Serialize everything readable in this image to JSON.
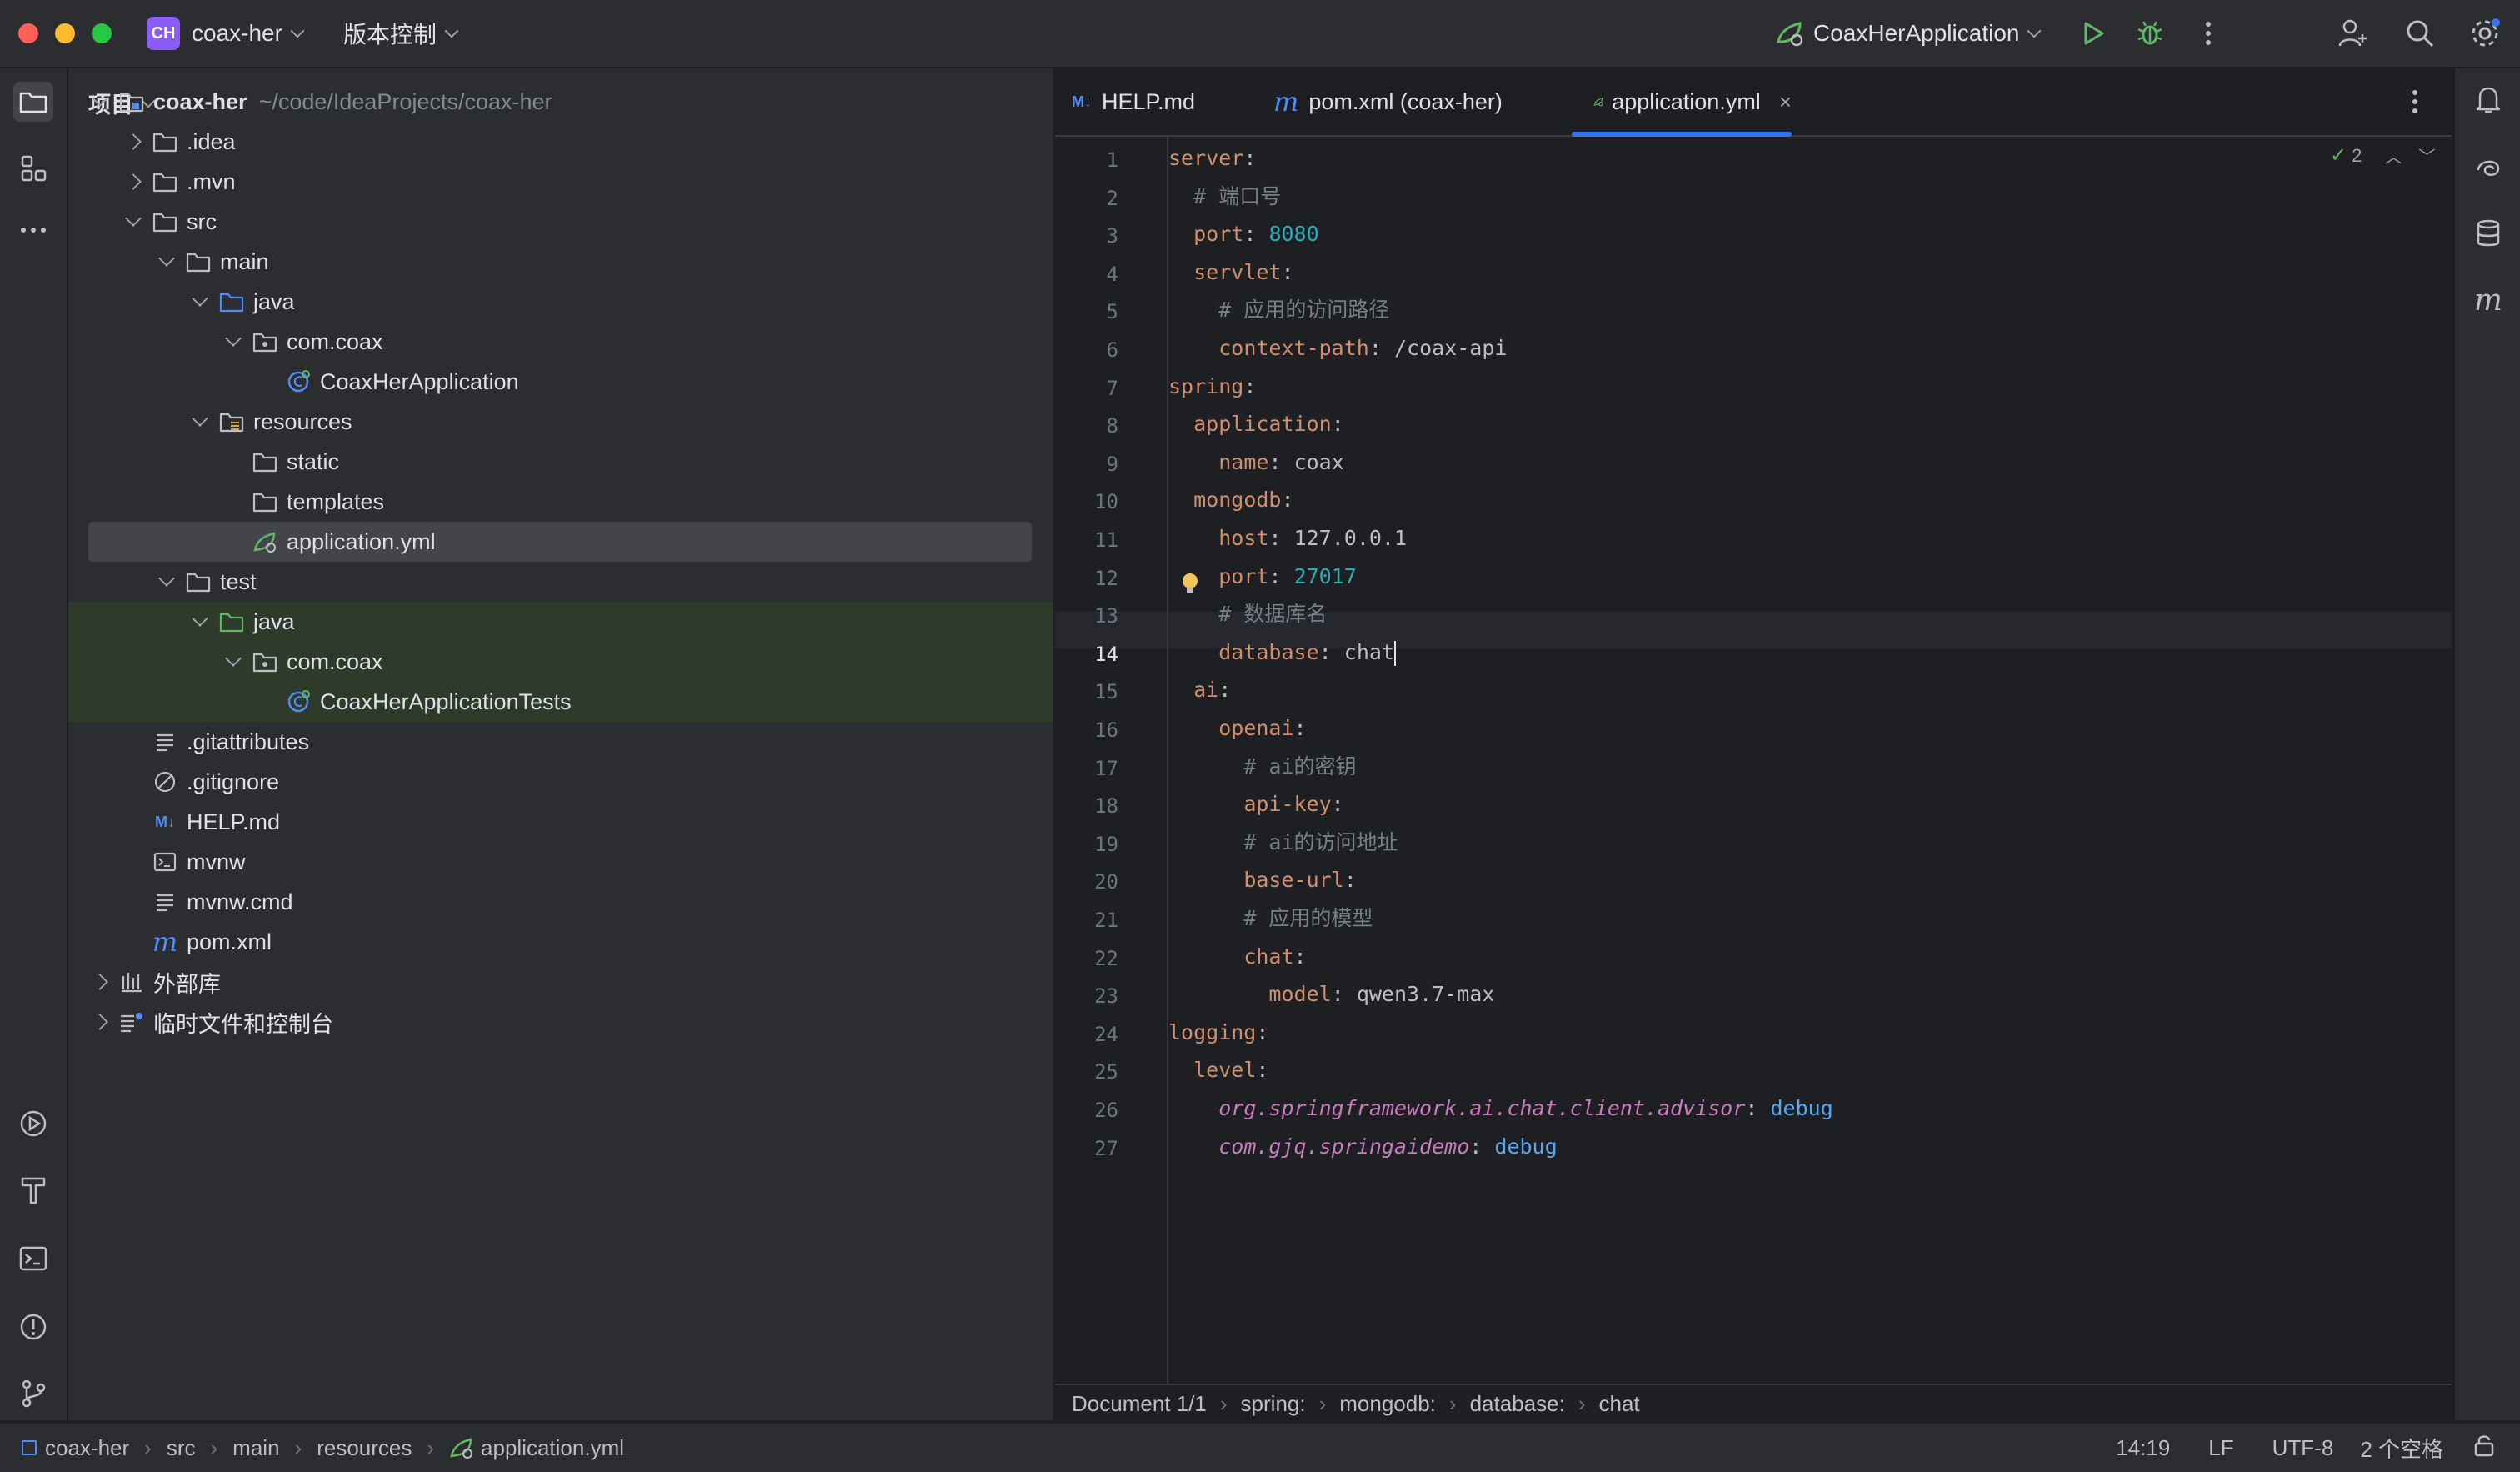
{
  "titlebar": {
    "project_badge": "CH",
    "project_name": "coax-her",
    "vcs_menu": "版本控制",
    "run_config": "CoaxHerApplication"
  },
  "project_panel": {
    "title": "项目",
    "tree": [
      {
        "label": "coax-her",
        "hint": "~/code/IdeaProjects/coax-her",
        "depth": 0,
        "arrow": "down",
        "icon": "module-folder-icon",
        "bold": true
      },
      {
        "label": ".idea",
        "depth": 1,
        "arrow": "right",
        "icon": "folder-icon"
      },
      {
        "label": ".mvn",
        "depth": 1,
        "arrow": "right",
        "icon": "folder-icon"
      },
      {
        "label": "src",
        "depth": 1,
        "arrow": "down",
        "icon": "folder-icon"
      },
      {
        "label": "main",
        "depth": 2,
        "arrow": "down",
        "icon": "folder-icon"
      },
      {
        "label": "java",
        "depth": 3,
        "arrow": "down",
        "icon": "source-folder-icon"
      },
      {
        "label": "com.coax",
        "depth": 4,
        "arrow": "down",
        "icon": "package-icon"
      },
      {
        "label": "CoaxHerApplication",
        "depth": 5,
        "arrow": "",
        "icon": "spring-class-icon"
      },
      {
        "label": "resources",
        "depth": 3,
        "arrow": "down",
        "icon": "resources-folder-icon"
      },
      {
        "label": "static",
        "depth": 4,
        "arrow": "",
        "icon": "folder-icon"
      },
      {
        "label": "templates",
        "depth": 4,
        "arrow": "",
        "icon": "folder-icon"
      },
      {
        "label": "application.yml",
        "depth": 4,
        "arrow": "",
        "icon": "spring-yml-icon",
        "selected": true
      },
      {
        "label": "test",
        "depth": 2,
        "arrow": "down",
        "icon": "folder-icon"
      },
      {
        "label": "java",
        "depth": 3,
        "arrow": "down",
        "icon": "test-folder-icon",
        "test": true
      },
      {
        "label": "com.coax",
        "depth": 4,
        "arrow": "down",
        "icon": "package-icon",
        "test": true
      },
      {
        "label": "CoaxHerApplicationTests",
        "depth": 5,
        "arrow": "",
        "icon": "spring-class-icon",
        "test": true
      },
      {
        "label": ".gitattributes",
        "depth": 1,
        "arrow": "",
        "icon": "text-file-icon"
      },
      {
        "label": ".gitignore",
        "depth": 1,
        "arrow": "",
        "icon": "ignore-file-icon"
      },
      {
        "label": "HELP.md",
        "depth": 1,
        "arrow": "",
        "icon": "markdown-icon"
      },
      {
        "label": "mvnw",
        "depth": 1,
        "arrow": "",
        "icon": "shell-script-icon"
      },
      {
        "label": "mvnw.cmd",
        "depth": 1,
        "arrow": "",
        "icon": "text-file-icon"
      },
      {
        "label": "pom.xml",
        "depth": 1,
        "arrow": "",
        "icon": "maven-icon"
      },
      {
        "label": "外部库",
        "depth": 0,
        "arrow": "right",
        "icon": "library-icon"
      },
      {
        "label": "临时文件和控制台",
        "depth": 0,
        "arrow": "right",
        "icon": "scratch-icon"
      }
    ]
  },
  "editor": {
    "tabs": [
      {
        "label": "HELP.md",
        "icon": "markdown-icon"
      },
      {
        "label": "pom.xml (coax-her)",
        "icon": "maven-icon"
      },
      {
        "label": "application.yml",
        "icon": "spring-yml-icon",
        "active": true
      }
    ],
    "inspection_count": "2",
    "current_line": 14,
    "lines": [
      "server:",
      "  # 端口号",
      "  port: 8080",
      "  servlet:",
      "    # 应用的访问路径",
      "    context-path: /coax-api",
      "spring:",
      "  application:",
      "    name: coax",
      "  mongodb:",
      "    host: 127.0.0.1",
      "    port: 27017",
      "    # 数据库名",
      "    database: chat",
      "  ai:",
      "    openai:",
      "      # ai的密钥",
      "      api-key:",
      "      # ai的访问地址",
      "      base-url:",
      "      # 应用的模型",
      "      chat:",
      "        model: qwen3.7-max",
      "logging:",
      "  level:",
      "    org.springframework.ai.chat.client.advisor: debug",
      "    com.gjq.springaidemo: debug"
    ],
    "breadcrumb": [
      "Document 1/1",
      "spring:",
      "mongodb:",
      "database:",
      "chat"
    ]
  },
  "statusbar": {
    "path": [
      "coax-her",
      "src",
      "main",
      "resources",
      "application.yml"
    ],
    "position": "14:19",
    "line_sep": "LF",
    "encoding": "UTF-8",
    "indent": "2 个空格"
  },
  "colors": {
    "accent": "#3574f0",
    "keyword": "#cf8e6d",
    "comment": "#7a7e85",
    "number": "#2aacb8",
    "debug": "#56a8f5",
    "run_green": "#5fb865"
  }
}
